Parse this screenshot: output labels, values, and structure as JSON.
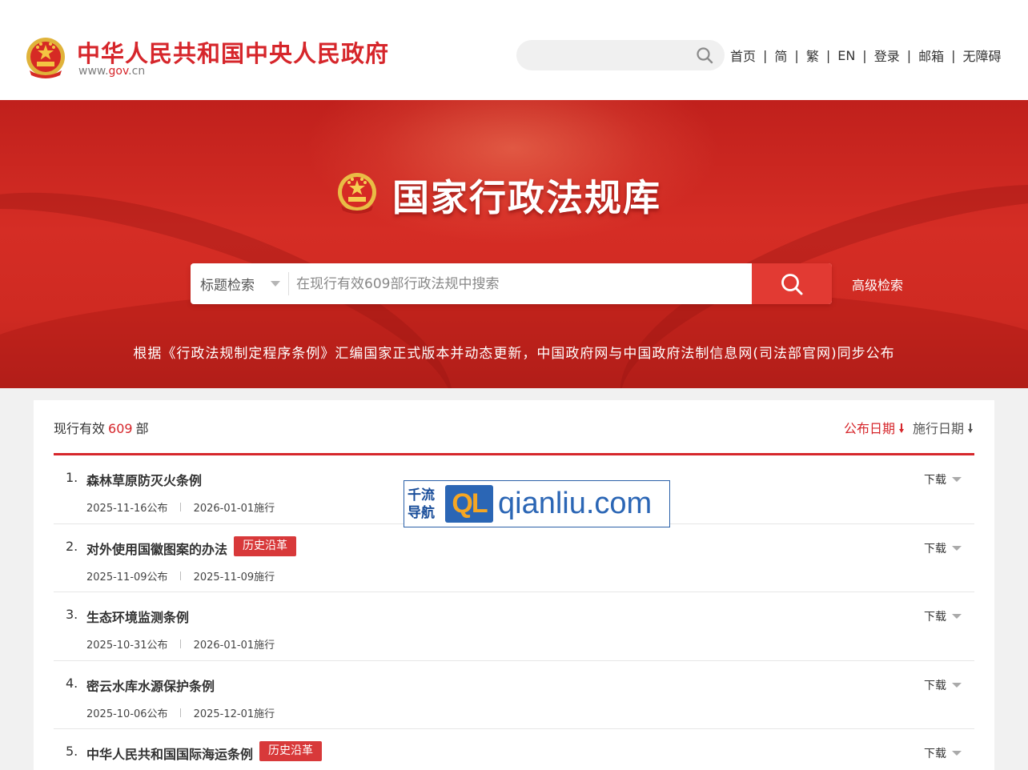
{
  "header": {
    "site_title": "中华人民共和国中央人民政府",
    "site_url_prefix": "www.",
    "site_url_brand": "gov",
    "site_url_suffix": ".cn",
    "search_placeholder": "",
    "nav": [
      "首页",
      "简",
      "繁",
      "EN",
      "登录",
      "邮箱",
      "无障碍"
    ],
    "nav_separator": "|"
  },
  "banner": {
    "title": "国家行政法规库",
    "search_type": "标题检索",
    "search_placeholder": "在现行有效609部行政法规中搜索",
    "advanced_search": "高级检索",
    "note": "根据《行政法规制定程序条例》汇编国家正式版本并动态更新，中国政府网与中国政府法制信息网(司法部官网)同步公布"
  },
  "results": {
    "count_prefix": "现行有效",
    "count": "609",
    "count_suffix": "部",
    "sort_publish": "公布日期",
    "sort_effective": "施行日期",
    "download_label": "下载",
    "items": [
      {
        "index": "1.",
        "title": "森林草原防灭火条例",
        "tag": "",
        "published": "2025-11-16公布",
        "effective": "2026-01-01施行"
      },
      {
        "index": "2.",
        "title": "对外使用国徽图案的办法",
        "tag": "历史沿革",
        "published": "2025-11-09公布",
        "effective": "2025-11-09施行"
      },
      {
        "index": "3.",
        "title": "生态环境监测条例",
        "tag": "",
        "published": "2025-10-31公布",
        "effective": "2026-01-01施行"
      },
      {
        "index": "4.",
        "title": "密云水库水源保护条例",
        "tag": "",
        "published": "2025-10-06公布",
        "effective": "2025-12-01施行"
      },
      {
        "index": "5.",
        "title": "中华人民共和国国际海运条例",
        "tag": "历史沿革",
        "published": "",
        "effective": ""
      }
    ]
  },
  "watermark": {
    "cn_line1": "千流",
    "cn_line2": "导航",
    "badge": "QL",
    "domain": "qianliu.com"
  },
  "colors": {
    "brand_red": "#d6262b",
    "banner_red": "#cf2a22",
    "search_button": "#e23a33",
    "tag_red": "#d8393a",
    "watermark_blue": "#2b66b5"
  },
  "icons": [
    "national-emblem-icon",
    "search-icon",
    "chevron-down-icon",
    "sort-arrow-icon"
  ]
}
